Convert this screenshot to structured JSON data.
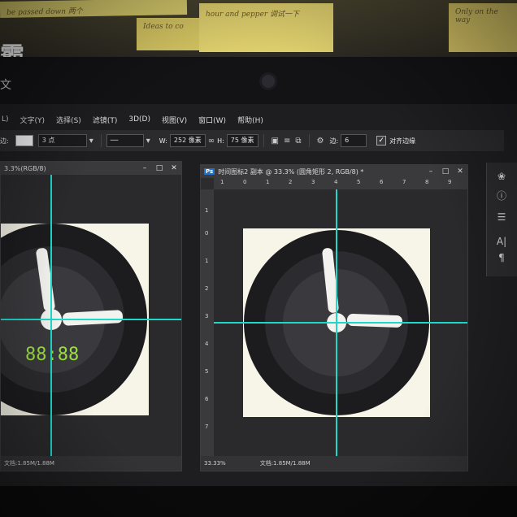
{
  "wall": {
    "logo_text": "霸",
    "sub_text": "文",
    "notes": [
      "be passed down 两个",
      "Ideas to co",
      "hour and pepper 调试一下",
      "Only on the way"
    ]
  },
  "menubar": {
    "items": [
      "L)",
      "文字(Y)",
      "选择(S)",
      "滤镜(T)",
      "3D(D)",
      "视图(V)",
      "窗口(W)",
      "帮助(H)"
    ]
  },
  "options": {
    "stroke_label": "边:",
    "stroke_width": "3 点",
    "w_label": "W:",
    "w_value": "252 像素",
    "link_icon": "∞",
    "h_label": "H:",
    "h_value": "75 像素",
    "gear_icon": "⚙",
    "sides_label": "边:",
    "sides_value": "6",
    "align_label": "对齐边缘",
    "align_checked": true
  },
  "left_window": {
    "title": "3.3%(RGB/8)",
    "digital_display": "88:88",
    "status": "文档:1.85M/1.88M"
  },
  "right_window": {
    "ps_badge": "Ps",
    "title": "时间图标2 副本 @ 33.3% (圆角矩形 2, RGB/8) *",
    "zoom": "33.33%",
    "status": "文档:1.85M/1.88M"
  },
  "window_buttons": {
    "minimize": "–",
    "maximize": "□",
    "close": "✕"
  },
  "ruler_h_labels": [
    "1",
    "0",
    "1",
    "2",
    "3",
    "4",
    "5",
    "6",
    "7",
    "8",
    "9"
  ],
  "ruler_v_labels": [
    "1",
    "0",
    "1",
    "2",
    "3",
    "4",
    "5",
    "6",
    "7"
  ],
  "colors": {
    "guide": "#1ed8c8",
    "clock_outer": "#1c1c1f",
    "clock_face": "#2c2c30",
    "clock_center": "#3a3a3e",
    "hands": "#f2f2ee",
    "canvas_bg": "#f7f4e8",
    "digital_green": "#9be23a"
  }
}
